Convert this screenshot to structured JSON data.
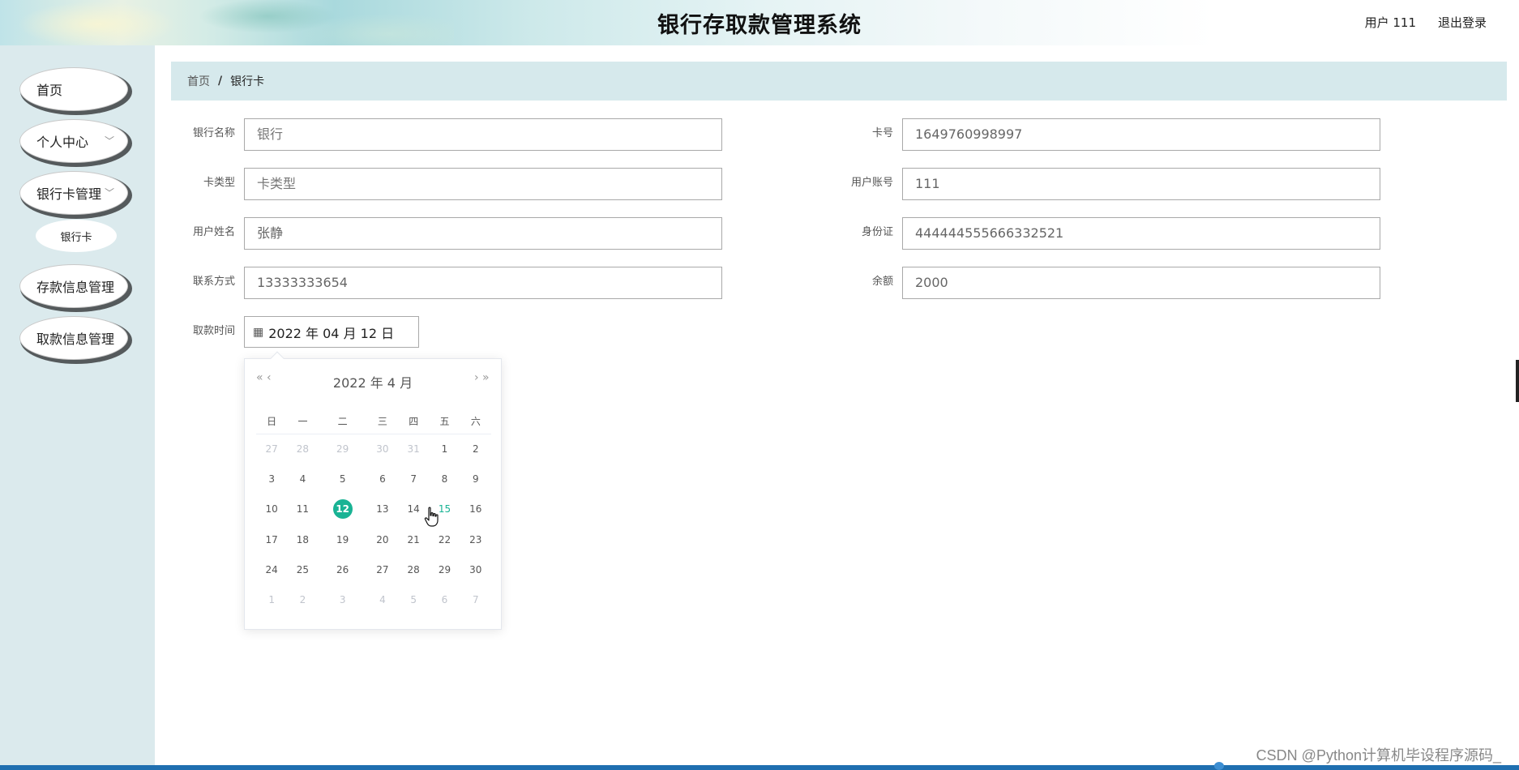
{
  "header": {
    "title": "银行存取款管理系统",
    "user": "用户 111",
    "logout": "退出登录"
  },
  "sidebar": {
    "items": [
      {
        "label": "首页"
      },
      {
        "label": "个人中心"
      },
      {
        "label": "银行卡管理"
      },
      {
        "label": "银行卡"
      },
      {
        "label": "存款信息管理"
      },
      {
        "label": "取款信息管理"
      }
    ]
  },
  "breadcrumb": {
    "home": "首页",
    "separator": "/",
    "current": "银行卡"
  },
  "form": {
    "bank_name": {
      "label": "银行名称",
      "placeholder": "银行"
    },
    "card_no": {
      "label": "卡号",
      "value": "1649760998997"
    },
    "card_type": {
      "label": "卡类型",
      "placeholder": "卡类型"
    },
    "user_account": {
      "label": "用户账号",
      "value": "111"
    },
    "user_name": {
      "label": "用户姓名",
      "value": "张静"
    },
    "id_card": {
      "label": "身份证",
      "value": "444444555666332521"
    },
    "contact": {
      "label": "联系方式",
      "value": "13333333654"
    },
    "balance": {
      "label": "余额",
      "value": "2000"
    },
    "withdraw_time": {
      "label": "取款时间",
      "value": "2022 年 04 月 12 日"
    }
  },
  "datepicker": {
    "header": "2022 年  4 月",
    "prev_year": "«",
    "prev_month": "‹",
    "next_month": "›",
    "next_year": "»",
    "weekdays": [
      "日",
      "一",
      "二",
      "三",
      "四",
      "五",
      "六"
    ],
    "weeks": [
      [
        [
          "27",
          "other"
        ],
        [
          "28",
          "other"
        ],
        [
          "29",
          "other"
        ],
        [
          "30",
          "other"
        ],
        [
          "31",
          "other"
        ],
        [
          "1",
          ""
        ],
        [
          "2",
          ""
        ]
      ],
      [
        [
          "3",
          ""
        ],
        [
          "4",
          ""
        ],
        [
          "5",
          ""
        ],
        [
          "6",
          ""
        ],
        [
          "7",
          ""
        ],
        [
          "8",
          ""
        ],
        [
          "9",
          ""
        ]
      ],
      [
        [
          "10",
          ""
        ],
        [
          "11",
          ""
        ],
        [
          "12",
          "selected"
        ],
        [
          "13",
          ""
        ],
        [
          "14",
          ""
        ],
        [
          "15",
          "today"
        ],
        [
          "16",
          ""
        ]
      ],
      [
        [
          "17",
          ""
        ],
        [
          "18",
          ""
        ],
        [
          "19",
          ""
        ],
        [
          "20",
          ""
        ],
        [
          "21",
          ""
        ],
        [
          "22",
          ""
        ],
        [
          "23",
          ""
        ]
      ],
      [
        [
          "24",
          ""
        ],
        [
          "25",
          ""
        ],
        [
          "26",
          ""
        ],
        [
          "27",
          ""
        ],
        [
          "28",
          ""
        ],
        [
          "29",
          ""
        ],
        [
          "30",
          ""
        ]
      ],
      [
        [
          "1",
          "other"
        ],
        [
          "2",
          "other"
        ],
        [
          "3",
          "other"
        ],
        [
          "4",
          "other"
        ],
        [
          "5",
          "other"
        ],
        [
          "6",
          "other"
        ],
        [
          "7",
          "other"
        ]
      ]
    ]
  },
  "watermark": "CSDN @Python计算机毕设程序源码_",
  "colors": {
    "accent": "#19b394",
    "sidebar_bg": "#dbeaed",
    "breadcrumb_bg": "#d6e9ec"
  }
}
